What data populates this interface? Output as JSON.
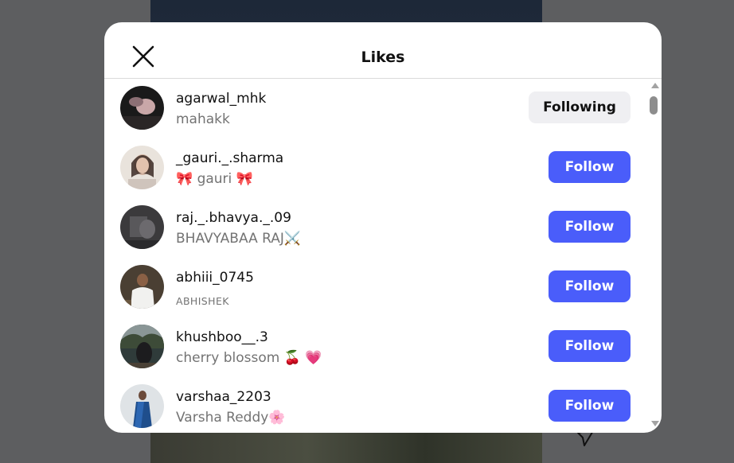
{
  "modal": {
    "title": "Likes",
    "close_icon": "close-icon"
  },
  "users": [
    {
      "username": "agarwal_mhk",
      "name": "mahakk",
      "button": "Following",
      "avatar_icon": "avatar-photo"
    },
    {
      "username": "_gauri._.sharma",
      "name": "🎀 gauri 🎀",
      "button": "Follow",
      "avatar_icon": "avatar-photo"
    },
    {
      "username": "raj._.bhavya._.09",
      "name": "BHAVYABAA RAJ⚔️",
      "button": "Follow",
      "avatar_icon": "avatar-photo"
    },
    {
      "username": "abhiii_0745",
      "name": "ABHISHEK",
      "button": "Follow",
      "avatar_icon": "avatar-photo"
    },
    {
      "username": "khushboo__.3",
      "name": "cherry blossom 🍒 💗",
      "button": "Follow",
      "avatar_icon": "avatar-photo"
    },
    {
      "username": "varshaa_2203",
      "name": "Varsha Reddy🌸",
      "button": "Follow",
      "avatar_icon": "avatar-photo"
    }
  ],
  "colors": {
    "follow_button": "#4a5dfa",
    "following_button": "#efeff2",
    "overlay": "#5d5e60"
  }
}
